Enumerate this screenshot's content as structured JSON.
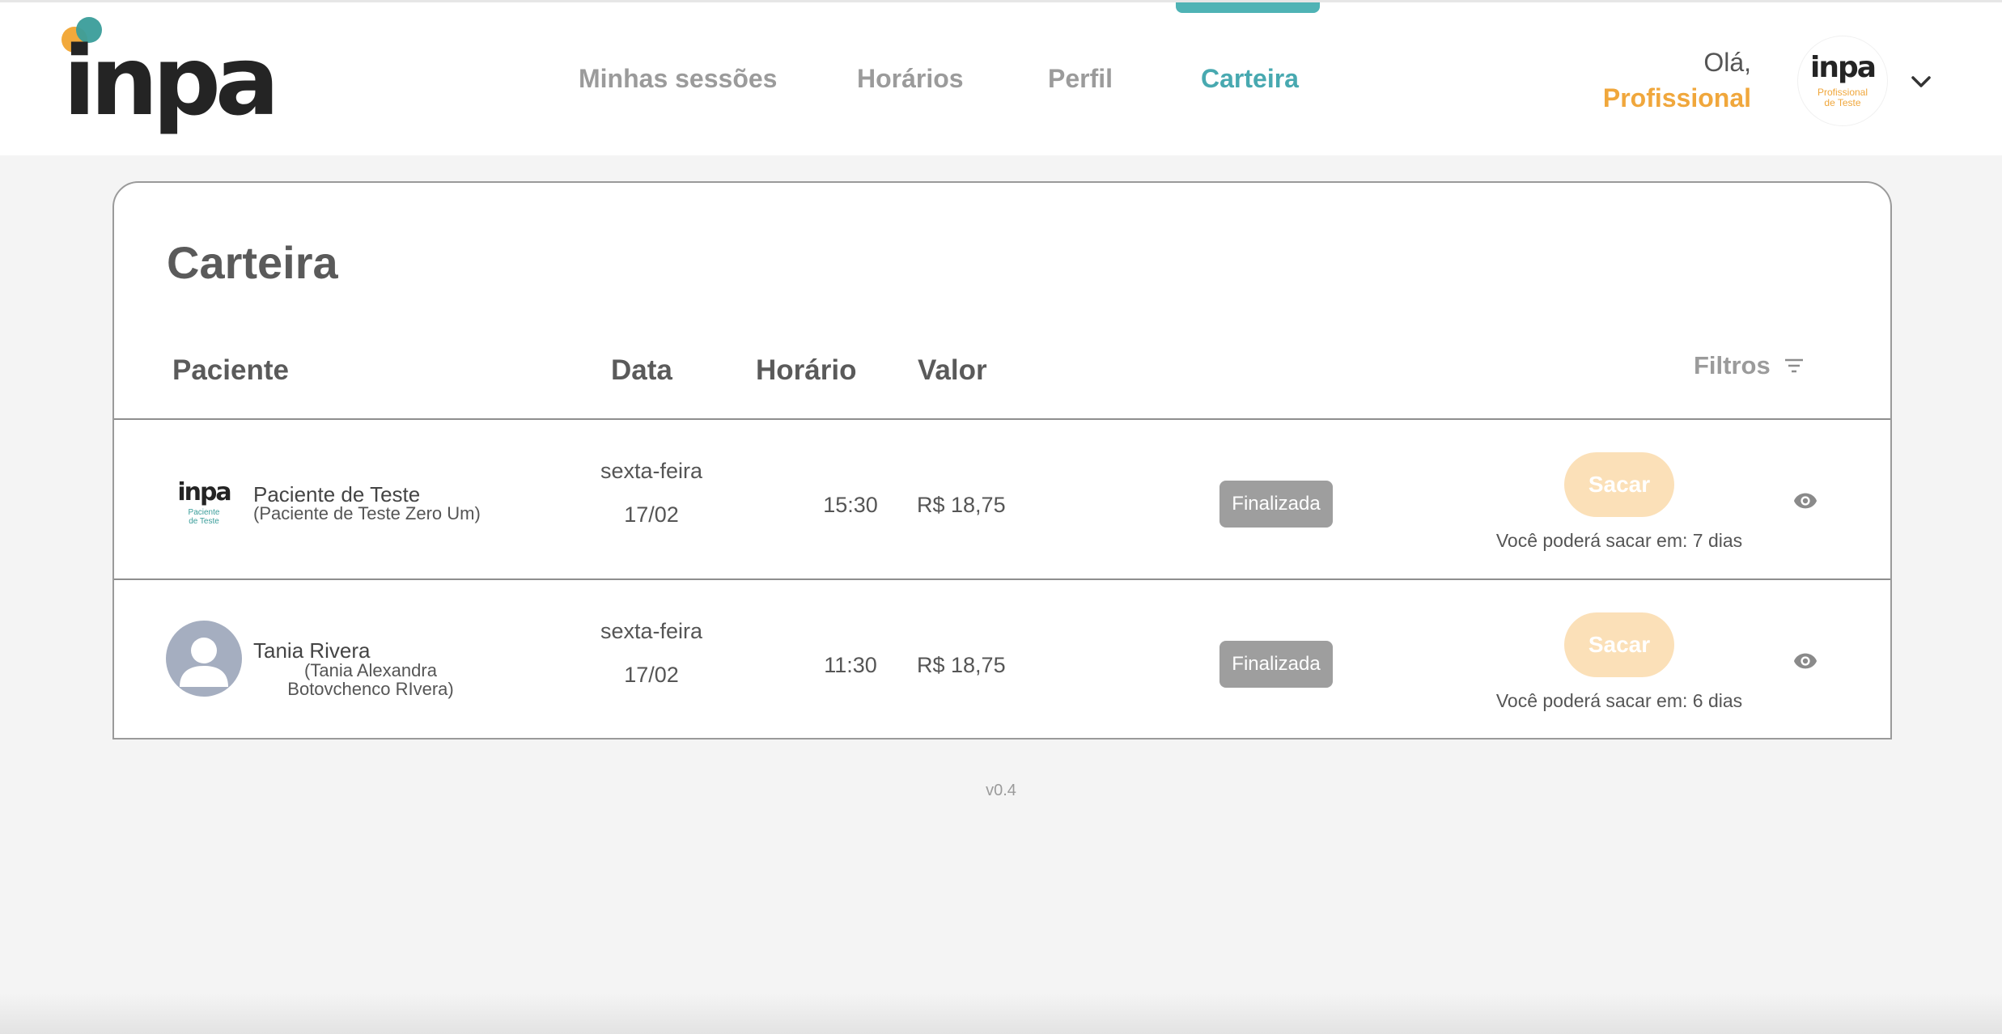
{
  "brand": {
    "logo_text": "inpa",
    "colors": {
      "orange": "#f2a93b",
      "teal": "#3a9d9a",
      "accent": "#48a9b0"
    }
  },
  "nav": {
    "items": [
      {
        "label": "Minhas sessões"
      },
      {
        "label": "Horários"
      },
      {
        "label": "Perfil"
      },
      {
        "label": "Carteira"
      }
    ],
    "active": "Carteira"
  },
  "user": {
    "greeting": "Olá,",
    "role": "Profissional",
    "avatar": {
      "logo_text": "inpa",
      "line1": "Profissional",
      "line2": "de Teste"
    },
    "menu_icon": "chevron-down-icon"
  },
  "page": {
    "title": "Carteira",
    "filters_label": "Filtros",
    "filters_icon": "filter-icon"
  },
  "table": {
    "headers": {
      "patient": "Paciente",
      "date": "Data",
      "time": "Horário",
      "value": "Valor"
    },
    "rows": [
      {
        "avatar_type": "logo",
        "avatar": {
          "logo_text": "inpa",
          "line1": "Paciente",
          "line2": "de Teste"
        },
        "name": "Paciente de Teste",
        "full_name": "(Paciente de Teste Zero Um)",
        "weekday": "sexta-feira",
        "date": "17/02",
        "time": "15:30",
        "value": "R$ 18,75",
        "status": "Finalizada",
        "action_label": "Sacar",
        "withdraw_note": "Você poderá sacar em: 7 dias",
        "view_icon": "eye-icon"
      },
      {
        "avatar_type": "placeholder",
        "name": "Tania Rivera",
        "full_name": "(Tania Alexandra Botovchenco RIvera)",
        "weekday": "sexta-feira",
        "date": "17/02",
        "time": "11:30",
        "value": "R$ 18,75",
        "status": "Finalizada",
        "action_label": "Sacar",
        "withdraw_note": "Você poderá sacar em: 6 dias",
        "view_icon": "eye-icon"
      }
    ]
  },
  "footer": {
    "version": "v0.4"
  }
}
